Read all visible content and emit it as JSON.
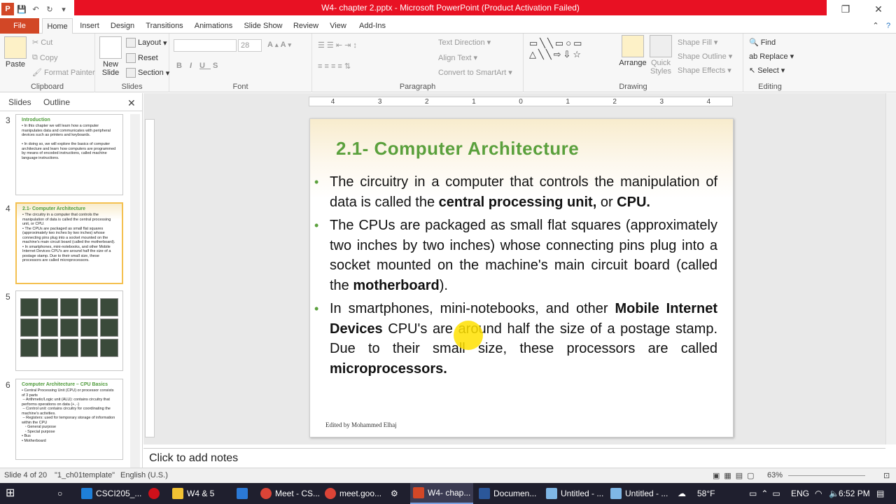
{
  "window": {
    "title": "W4- chapter 2.pptx - Microsoft PowerPoint (Product Activation Failed)",
    "logo": "P"
  },
  "tabs": [
    "File",
    "Home",
    "Insert",
    "Design",
    "Transitions",
    "Animations",
    "Slide Show",
    "Review",
    "View",
    "Add-Ins"
  ],
  "ribbon": {
    "clipboard": {
      "label": "Clipboard",
      "paste": "Paste",
      "cut": "Cut",
      "copy": "Copy",
      "format_painter": "Format Painter"
    },
    "slides": {
      "label": "Slides",
      "new_slide": "New Slide",
      "layout": "Layout",
      "reset": "Reset",
      "section": "Section"
    },
    "font": {
      "label": "Font",
      "size": "28"
    },
    "paragraph": {
      "label": "Paragraph",
      "text_direction": "Text Direction",
      "align_text": "Align Text",
      "convert": "Convert to SmartArt"
    },
    "drawing": {
      "label": "Drawing",
      "arrange": "Arrange",
      "quick_styles": "Quick Styles",
      "shape_fill": "Shape Fill",
      "shape_outline": "Shape Outline",
      "shape_effects": "Shape Effects"
    },
    "editing": {
      "label": "Editing",
      "find": "Find",
      "replace": "Replace",
      "select": "Select"
    }
  },
  "left_pane": {
    "tabs": [
      "Slides",
      "Outline"
    ],
    "thumbs": [
      {
        "num": "3",
        "title": "Introduction",
        "text": "• In this chapter we will learn how a computer manipulates data and communicates with peripheral devices such as printers and keyboards.\n\n• In doing so, we will explore the basics of computer architecture and learn how computers are programmed by means of encoded instructions, called machine language instructions."
      },
      {
        "num": "4",
        "title": "2.1- Computer Architecture",
        "text": "• The circuitry in a computer that controls the manipulation of data is called the central processing unit, or CPU.\n• The CPUs are packaged as small flat squares (approximately two inches by two inches) whose connecting pins plug into a socket mounted on the machine's main circuit board (called the motherboard).\n• In smartphones, mini-notebooks, and other Mobile Internet Devices CPU's are around half the size of a postage stamp. Due to their small size, these processors are called microprocessors."
      },
      {
        "num": "5"
      },
      {
        "num": "6",
        "title": "Computer Architecture – CPU Basics",
        "text": "• Central Processing Unit (CPU) or processor consists of 3 parts\n – Arithmetic/Logic unit (ALU): contains circuitry that performs operations on data (+, -)\n – Control unit: contains circuitry for coordinating the machine's activities.\n – Registers: used for temporary storage of information within the CPU\n   ◦ General purpose\n   ◦ Special purpose\n• Bus\n• Motherboard"
      }
    ]
  },
  "ruler": [
    "4",
    "3",
    "2",
    "1",
    "0",
    "1",
    "2",
    "3",
    "4"
  ],
  "slide": {
    "title": "2.1- Computer Architecture",
    "b1_pre": "The circuitry in a computer that controls the manipulation of data is called the ",
    "b1_bold": "central processing unit,",
    "b1_mid": " or ",
    "b1_bold2": "CPU.",
    "b2_pre": "The CPUs are packaged as small flat squares (approximately two inches by two inches) whose connecting pins plug into a socket mounted on the machine's main circuit board (called the ",
    "b2_bold": "motherboard",
    "b2_post": ").",
    "b3_pre": "In smartphones, mini-notebooks, and other ",
    "b3_bold": "Mobile Internet Devices",
    "b3_mid": " CPU's are around half the size of a postage stamp. Due to their small size, these processors are called ",
    "b3_bold2": "microprocessors.",
    "footer": "Edited by Mohammed Elhaj"
  },
  "notes_placeholder": "Click to add notes",
  "status": {
    "slide": "Slide 4 of 20",
    "template": "\"1_ch01template\"",
    "language": "English (U.S.)",
    "zoom": "63%"
  },
  "taskbar": {
    "items": [
      "CSCI205_...",
      "W4 & 5",
      "Meet - CS...",
      "meet.goo...",
      "W4- chap...",
      "Documen...",
      "Untitled - ...",
      "Untitled - ..."
    ],
    "temp": "58°F",
    "lang": "ENG",
    "time": "6:52 PM"
  }
}
